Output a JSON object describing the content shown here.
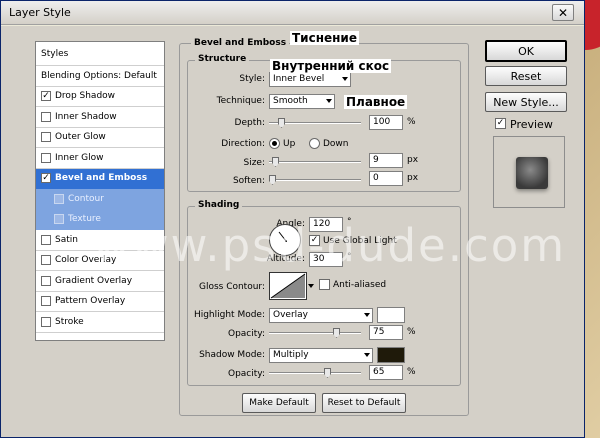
{
  "window": {
    "title": "Layer Style",
    "close_glyph": "✕"
  },
  "sidebar": {
    "header": "Styles",
    "items": [
      {
        "label": "Blending Options: Default",
        "checkbox": false,
        "checked": false
      },
      {
        "label": "Drop Shadow",
        "checkbox": true,
        "checked": true
      },
      {
        "label": "Inner Shadow",
        "checkbox": true,
        "checked": false
      },
      {
        "label": "Outer Glow",
        "checkbox": true,
        "checked": false
      },
      {
        "label": "Inner Glow",
        "checkbox": true,
        "checked": false
      },
      {
        "label": "Bevel and Emboss",
        "checkbox": true,
        "checked": true,
        "active": true
      },
      {
        "label": "Contour",
        "checkbox": true,
        "checked": false,
        "sub": true
      },
      {
        "label": "Texture",
        "checkbox": true,
        "checked": false,
        "sub": true
      },
      {
        "label": "Satin",
        "checkbox": true,
        "checked": false
      },
      {
        "label": "Color Overlay",
        "checkbox": true,
        "checked": false
      },
      {
        "label": "Gradient Overlay",
        "checkbox": true,
        "checked": false
      },
      {
        "label": "Pattern Overlay",
        "checkbox": true,
        "checked": false
      },
      {
        "label": "Stroke",
        "checkbox": true,
        "checked": false
      }
    ],
    "check_glyph": "✓"
  },
  "bevel": {
    "title": "Bevel and Emboss",
    "structure_title": "Structure",
    "style_label": "Style:",
    "style_value": "Inner Bevel",
    "technique_label": "Technique:",
    "technique_value": "Smooth",
    "depth_label": "Depth:",
    "depth_value": "100",
    "depth_unit": "%",
    "depth_slider": 0.1,
    "direction_label": "Direction:",
    "dir_up": "Up",
    "dir_down": "Down",
    "direction_selected": "Up",
    "size_label": "Size:",
    "size_value": "9",
    "size_unit": "px",
    "size_slider": 0.04,
    "soften_label": "Soften:",
    "soften_value": "0",
    "soften_unit": "px",
    "soften_slider": 0.0,
    "shading_title": "Shading",
    "angle_label": "Angle:",
    "angle_value": "120",
    "angle_unit": "°",
    "global_light_label": "Use Global Light",
    "global_light_checked": true,
    "altitude_label": "Altitude:",
    "altitude_value": "30",
    "altitude_unit": "°",
    "gloss_label": "Gloss Contour:",
    "anti_aliased_label": "Anti-aliased",
    "anti_aliased_checked": false,
    "highlight_mode_label": "Highlight Mode:",
    "highlight_mode_value": "Overlay",
    "highlight_color": "#ffffff",
    "hl_opacity_label": "Opacity:",
    "hl_opacity_value": "75",
    "hl_opacity_unit": "%",
    "hl_opacity_slider": 0.75,
    "shadow_mode_label": "Shadow Mode:",
    "shadow_mode_value": "Multiply",
    "shadow_color": "#1f1a0a",
    "sh_opacity_label": "Opacity:",
    "sh_opacity_value": "65",
    "sh_opacity_unit": "%",
    "sh_opacity_slider": 0.65,
    "make_default": "Make Default",
    "reset_default": "Reset to Default"
  },
  "right": {
    "ok": "OK",
    "reset": "Reset",
    "new_style": "New Style...",
    "preview_label": "Preview",
    "preview_checked": true
  },
  "annotations": {
    "emboss": "Тиснение",
    "inner_bevel": "Внутренний скос",
    "smooth": "Плавное"
  },
  "watermark": "www.psd-dude.com",
  "colors": {
    "active_blue": "#3170d3",
    "sub_blue": "#7ea4e0",
    "dialog_gray": "#d4d0c8"
  }
}
